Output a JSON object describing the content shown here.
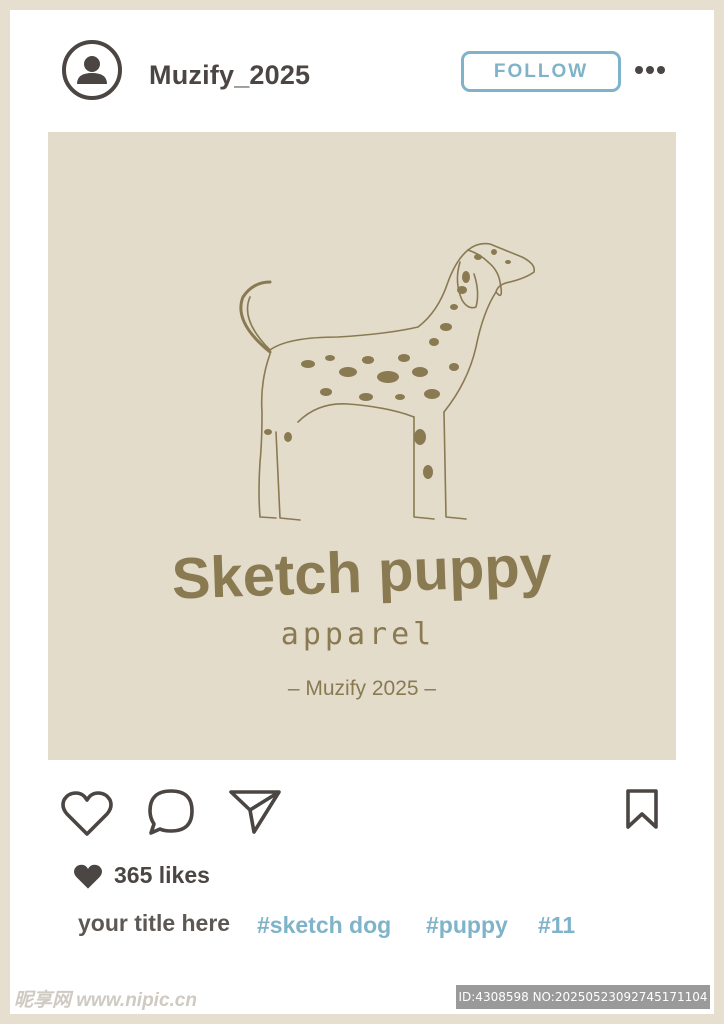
{
  "header": {
    "username": "Muzify_2025",
    "follow_label": "FOLLOW",
    "avatar_icon": "user-avatar-icon",
    "more_icon": "more-dots-icon"
  },
  "post": {
    "title": "Sketch puppy",
    "subtitle": "apparel",
    "credit": "– Muzify 2025 –",
    "background": "#e3dccb",
    "ink_color": "#8a7a52"
  },
  "actions": {
    "like_icon": "heart-outline-icon",
    "comment_icon": "comment-bubble-icon",
    "share_icon": "paper-plane-icon",
    "save_icon": "bookmark-icon"
  },
  "likes": {
    "icon": "heart-filled-icon",
    "label": "365 likes"
  },
  "caption": {
    "title": "your title here",
    "tags": [
      "#sketch dog",
      "#puppy",
      "#11"
    ]
  },
  "footer": {
    "watermark": "昵享网 www.nipic.cn",
    "id_text": "ID:4308598 NO:20250523092745171104"
  },
  "colors": {
    "frame": "#e6dfd0",
    "dark": "#4b4643",
    "accent": "#7fb3c9"
  }
}
